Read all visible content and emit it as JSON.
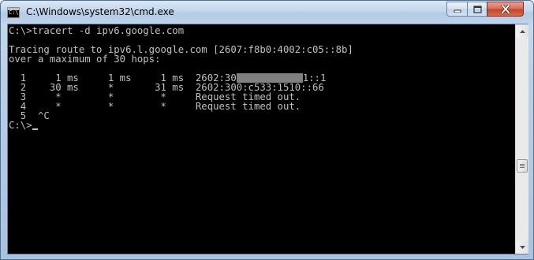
{
  "window": {
    "title": "C:\\Windows\\system32\\cmd.exe",
    "icon": "cmd-console-icon",
    "icon_text": "C:\\"
  },
  "controls": {
    "minimize": "minimize-icon",
    "maximize": "maximize-icon",
    "close": "close-icon"
  },
  "console": {
    "lines": [
      "C:\\>tracert -d ipv6.google.com",
      "",
      "Tracing route to ipv6.l.google.com [2607:f8b0:4002:c05::8b]",
      "over a maximum of 30 hops:",
      "",
      "  1     1 ms     1 ms     1 ms  2602:30",
      "  2    30 ms     *       31 ms  2602:300:c533:1510::66",
      "  3     *        *        *     Request timed out.",
      "  4     *        *        *     Request timed out.",
      "  5  ^C",
      "C:\\>"
    ],
    "hop1_suffix": "1::1",
    "redaction_color": "#808080",
    "background": "#000000",
    "foreground": "#c0c0c0"
  }
}
